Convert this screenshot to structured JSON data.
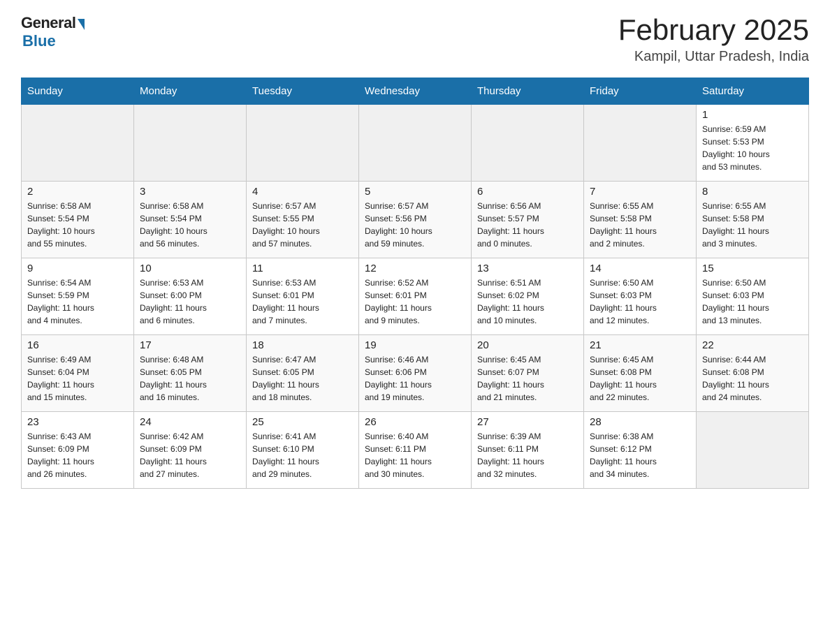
{
  "header": {
    "logo_general": "General",
    "logo_blue": "Blue",
    "month_title": "February 2025",
    "subtitle": "Kampil, Uttar Pradesh, India"
  },
  "weekdays": [
    "Sunday",
    "Monday",
    "Tuesday",
    "Wednesday",
    "Thursday",
    "Friday",
    "Saturday"
  ],
  "weeks": [
    [
      {
        "day": "",
        "info": ""
      },
      {
        "day": "",
        "info": ""
      },
      {
        "day": "",
        "info": ""
      },
      {
        "day": "",
        "info": ""
      },
      {
        "day": "",
        "info": ""
      },
      {
        "day": "",
        "info": ""
      },
      {
        "day": "1",
        "info": "Sunrise: 6:59 AM\nSunset: 5:53 PM\nDaylight: 10 hours\nand 53 minutes."
      }
    ],
    [
      {
        "day": "2",
        "info": "Sunrise: 6:58 AM\nSunset: 5:54 PM\nDaylight: 10 hours\nand 55 minutes."
      },
      {
        "day": "3",
        "info": "Sunrise: 6:58 AM\nSunset: 5:54 PM\nDaylight: 10 hours\nand 56 minutes."
      },
      {
        "day": "4",
        "info": "Sunrise: 6:57 AM\nSunset: 5:55 PM\nDaylight: 10 hours\nand 57 minutes."
      },
      {
        "day": "5",
        "info": "Sunrise: 6:57 AM\nSunset: 5:56 PM\nDaylight: 10 hours\nand 59 minutes."
      },
      {
        "day": "6",
        "info": "Sunrise: 6:56 AM\nSunset: 5:57 PM\nDaylight: 11 hours\nand 0 minutes."
      },
      {
        "day": "7",
        "info": "Sunrise: 6:55 AM\nSunset: 5:58 PM\nDaylight: 11 hours\nand 2 minutes."
      },
      {
        "day": "8",
        "info": "Sunrise: 6:55 AM\nSunset: 5:58 PM\nDaylight: 11 hours\nand 3 minutes."
      }
    ],
    [
      {
        "day": "9",
        "info": "Sunrise: 6:54 AM\nSunset: 5:59 PM\nDaylight: 11 hours\nand 4 minutes."
      },
      {
        "day": "10",
        "info": "Sunrise: 6:53 AM\nSunset: 6:00 PM\nDaylight: 11 hours\nand 6 minutes."
      },
      {
        "day": "11",
        "info": "Sunrise: 6:53 AM\nSunset: 6:01 PM\nDaylight: 11 hours\nand 7 minutes."
      },
      {
        "day": "12",
        "info": "Sunrise: 6:52 AM\nSunset: 6:01 PM\nDaylight: 11 hours\nand 9 minutes."
      },
      {
        "day": "13",
        "info": "Sunrise: 6:51 AM\nSunset: 6:02 PM\nDaylight: 11 hours\nand 10 minutes."
      },
      {
        "day": "14",
        "info": "Sunrise: 6:50 AM\nSunset: 6:03 PM\nDaylight: 11 hours\nand 12 minutes."
      },
      {
        "day": "15",
        "info": "Sunrise: 6:50 AM\nSunset: 6:03 PM\nDaylight: 11 hours\nand 13 minutes."
      }
    ],
    [
      {
        "day": "16",
        "info": "Sunrise: 6:49 AM\nSunset: 6:04 PM\nDaylight: 11 hours\nand 15 minutes."
      },
      {
        "day": "17",
        "info": "Sunrise: 6:48 AM\nSunset: 6:05 PM\nDaylight: 11 hours\nand 16 minutes."
      },
      {
        "day": "18",
        "info": "Sunrise: 6:47 AM\nSunset: 6:05 PM\nDaylight: 11 hours\nand 18 minutes."
      },
      {
        "day": "19",
        "info": "Sunrise: 6:46 AM\nSunset: 6:06 PM\nDaylight: 11 hours\nand 19 minutes."
      },
      {
        "day": "20",
        "info": "Sunrise: 6:45 AM\nSunset: 6:07 PM\nDaylight: 11 hours\nand 21 minutes."
      },
      {
        "day": "21",
        "info": "Sunrise: 6:45 AM\nSunset: 6:08 PM\nDaylight: 11 hours\nand 22 minutes."
      },
      {
        "day": "22",
        "info": "Sunrise: 6:44 AM\nSunset: 6:08 PM\nDaylight: 11 hours\nand 24 minutes."
      }
    ],
    [
      {
        "day": "23",
        "info": "Sunrise: 6:43 AM\nSunset: 6:09 PM\nDaylight: 11 hours\nand 26 minutes."
      },
      {
        "day": "24",
        "info": "Sunrise: 6:42 AM\nSunset: 6:09 PM\nDaylight: 11 hours\nand 27 minutes."
      },
      {
        "day": "25",
        "info": "Sunrise: 6:41 AM\nSunset: 6:10 PM\nDaylight: 11 hours\nand 29 minutes."
      },
      {
        "day": "26",
        "info": "Sunrise: 6:40 AM\nSunset: 6:11 PM\nDaylight: 11 hours\nand 30 minutes."
      },
      {
        "day": "27",
        "info": "Sunrise: 6:39 AM\nSunset: 6:11 PM\nDaylight: 11 hours\nand 32 minutes."
      },
      {
        "day": "28",
        "info": "Sunrise: 6:38 AM\nSunset: 6:12 PM\nDaylight: 11 hours\nand 34 minutes."
      },
      {
        "day": "",
        "info": ""
      }
    ]
  ]
}
